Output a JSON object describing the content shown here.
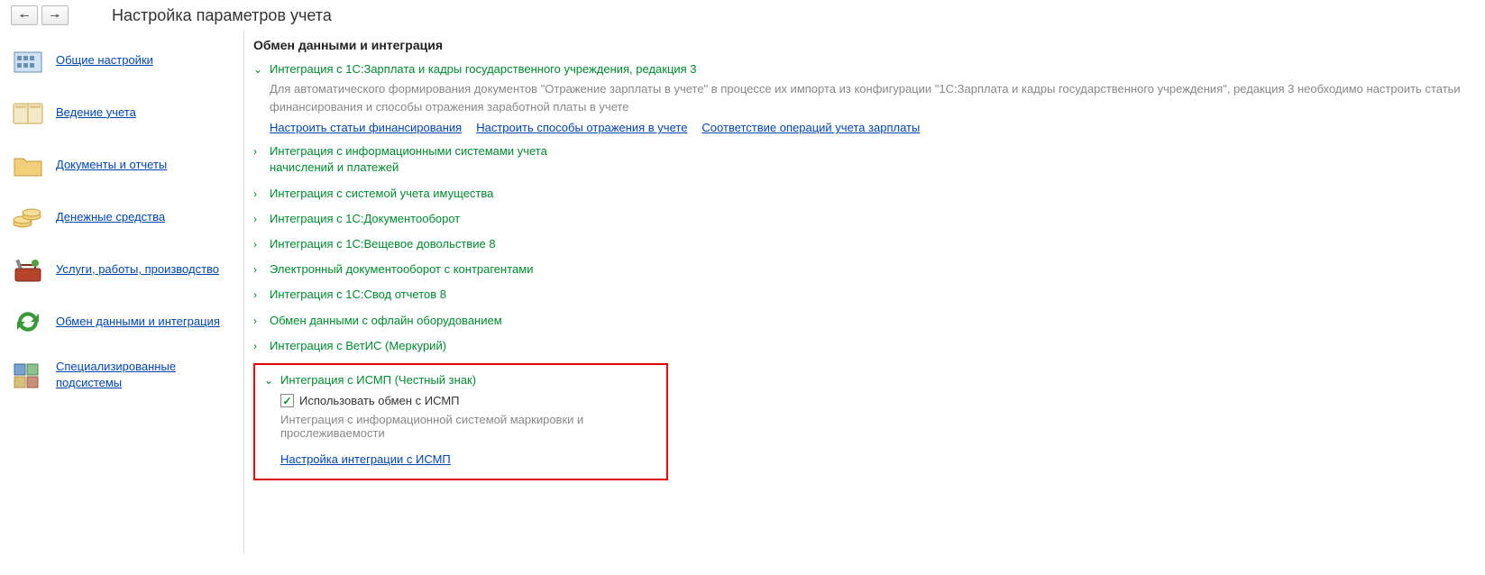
{
  "header": {
    "title": "Настройка параметров учета"
  },
  "sidebar": {
    "items": [
      {
        "label": "Общие настройки"
      },
      {
        "label": "Ведение учета"
      },
      {
        "label": "Документы и отчеты"
      },
      {
        "label": "Денежные средства"
      },
      {
        "label": "Услуги, работы, производство"
      },
      {
        "label": "Обмен данными и интеграция"
      },
      {
        "label": "Специализированные подсистемы"
      }
    ]
  },
  "main": {
    "section_title": "Обмен данными и интеграция",
    "group0": {
      "title": "Интеграция с 1С:Зарплата и кадры государственного учреждения, редакция 3",
      "desc": "Для автоматического формирования документов \"Отражение зарплаты в учете\" в процессе их импорта из конфигурации \"1С:Зарплата и кадры государственного учреждения\", редакция 3 необходимо настроить  статьи финансирования и способы отражения заработной платы в учете",
      "links": {
        "a": "Настроить статьи финансирования",
        "b": "Настроить способы отражения в учете",
        "c": "Соответствие операций учета зарплаты"
      }
    },
    "groups": [
      {
        "title": "Интеграция с информационными системами учета начислений и платежей"
      },
      {
        "title": "Интеграция с системой учета имущества"
      },
      {
        "title": "Интеграция с 1С:Документооборот"
      },
      {
        "title": "Интеграция с 1С:Вещевое довольствие 8"
      },
      {
        "title": "Электронный документооборот с контрагентами"
      },
      {
        "title": "Интеграция с 1С:Свод отчетов 8"
      },
      {
        "title": "Обмен данными с офлайн оборудованием"
      },
      {
        "title": "Интеграция с ВетИС (Меркурий)"
      }
    ],
    "ismp": {
      "title": "Интеграция с ИСМП (Честный знак)",
      "checkbox_label": "Использовать обмен с ИСМП",
      "desc": "Интеграция с информационной системой маркировки и прослеживаемости",
      "link": "Настройка интеграции с ИСМП"
    }
  }
}
